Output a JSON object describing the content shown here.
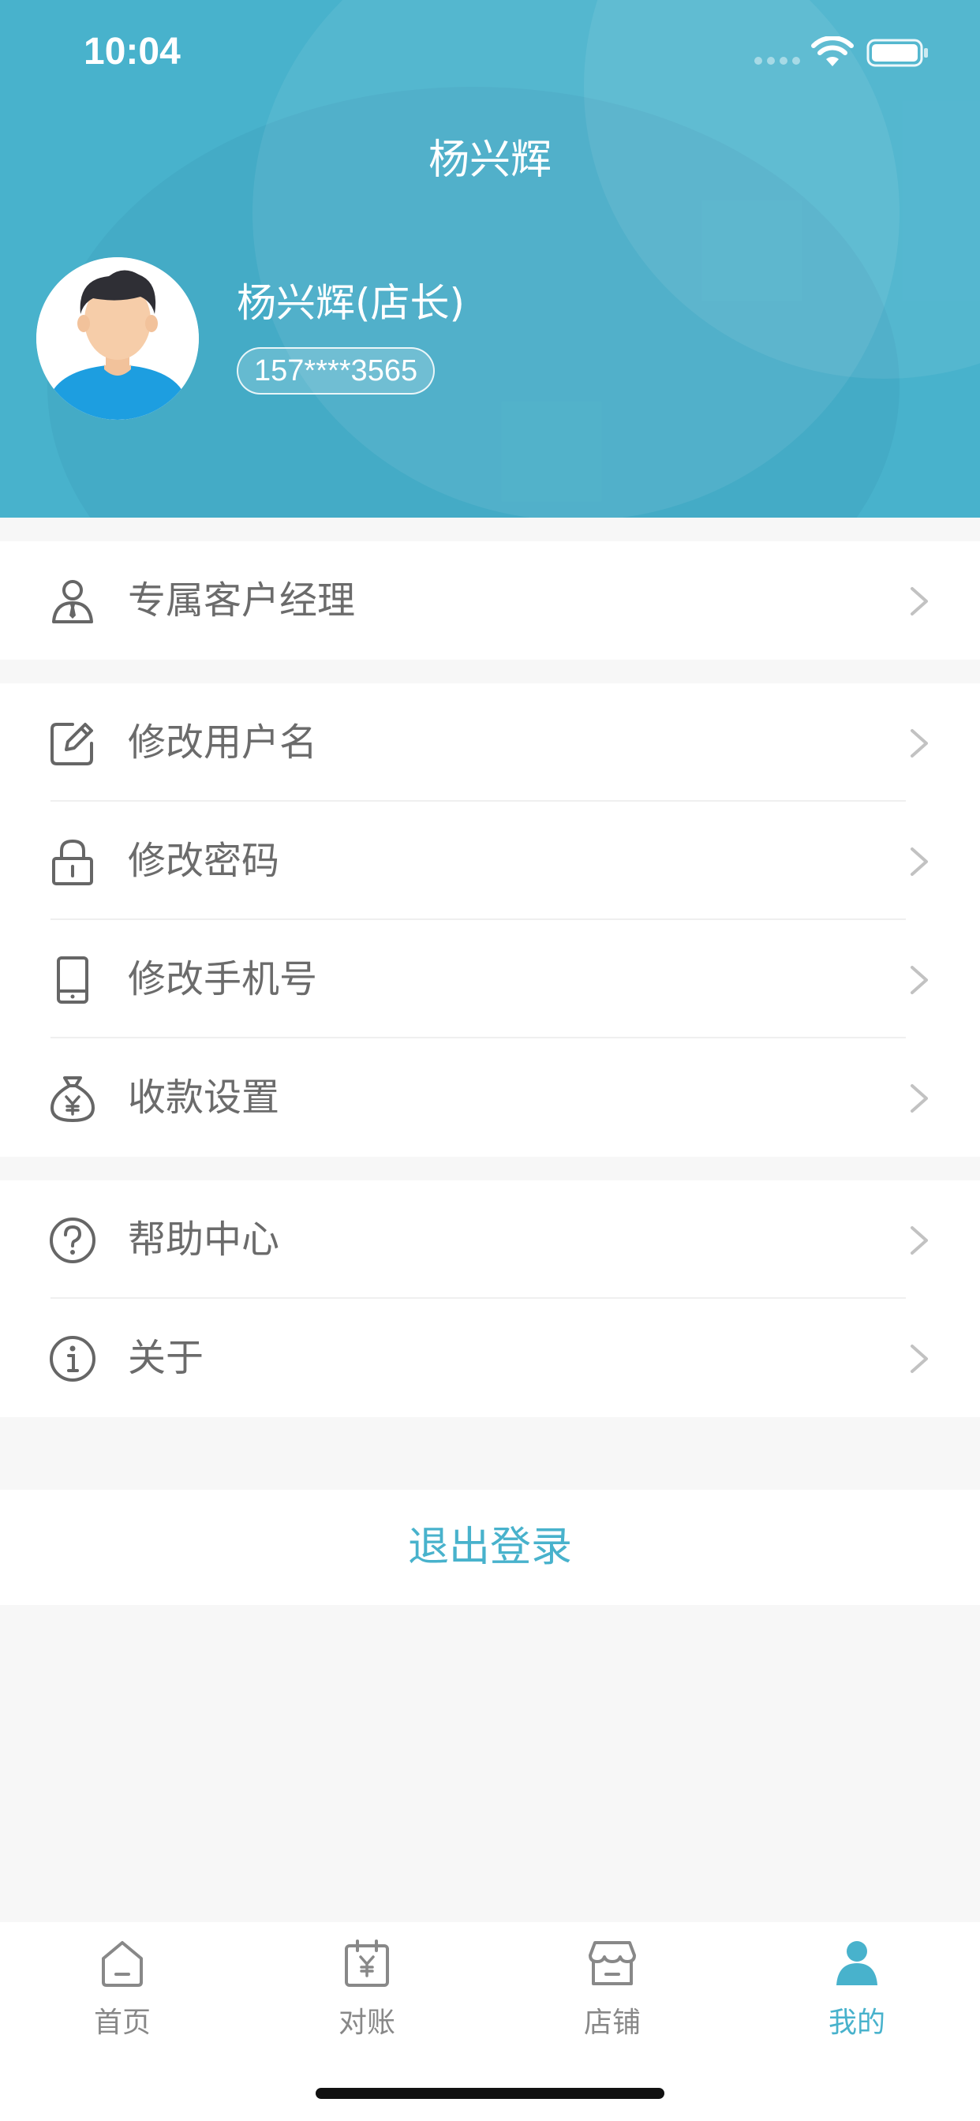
{
  "status_bar": {
    "time": "10:04"
  },
  "header": {
    "title": "杨兴辉",
    "user_name": "杨兴辉(店长)",
    "phone": "157****3565"
  },
  "menu": {
    "group1": [
      {
        "icon": "person-tie-icon",
        "label": "专属客户经理"
      }
    ],
    "group2": [
      {
        "icon": "edit-icon",
        "label": "修改用户名"
      },
      {
        "icon": "lock-icon",
        "label": "修改密码"
      },
      {
        "icon": "phone-icon",
        "label": "修改手机号"
      },
      {
        "icon": "money-bag-icon",
        "label": "收款设置"
      }
    ],
    "group3": [
      {
        "icon": "help-icon",
        "label": "帮助中心"
      },
      {
        "icon": "info-icon",
        "label": "关于"
      }
    ]
  },
  "logout_label": "退出登录",
  "tabbar": {
    "tabs": [
      {
        "label": "首页",
        "icon": "home-icon",
        "active": false
      },
      {
        "label": "对账",
        "icon": "calendar-yen-icon",
        "active": false
      },
      {
        "label": "店铺",
        "icon": "store-icon",
        "active": false
      },
      {
        "label": "我的",
        "icon": "person-icon",
        "active": true
      }
    ]
  },
  "colors": {
    "accent": "#48b2cc",
    "header_bg": "#48b2cc",
    "page_bg": "#f7f7f7",
    "label_text": "#6b6b6b"
  }
}
